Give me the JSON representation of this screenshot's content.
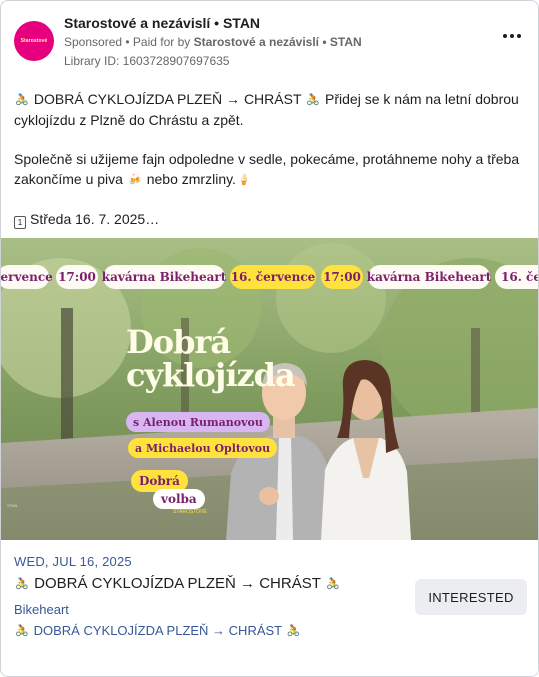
{
  "advertiser": {
    "avatar_text": "Starostové",
    "name": "Starostové a nezávislí • STAN",
    "sponsored_label": "Sponsored",
    "paid_for_prefix": " • Paid for by ",
    "payer": "Starostové a nezávislí • STAN",
    "library_id": "Library ID: 1603728907697635"
  },
  "post": {
    "line1": "DOBRÁ CYKLOJÍZDA PLZEŇ → CHRÁST",
    "line1_rest": "Přidej se k nám na letní dobrou cyklojízdu z Plzně do Chrástu a zpět.",
    "line2": "Společně si užijeme fajn odpoledne v sedle, pokecáme, protáhneme nohy a třeba zakončíme u piva",
    "line2_mid": "nebo zmrzliny.",
    "line3": "Středa 16. 7. 2025…",
    "emoji_bike": "🚴",
    "emoji_beer": "🍻",
    "emoji_icecream": "🍦",
    "emoji_calendar": "1"
  },
  "media": {
    "ticker": [
      "července",
      "17:00",
      "kavárna Bikeheart",
      "16. července",
      "17:00",
      "kavárna Bikeheart",
      "16. če"
    ],
    "headline_1": "Dobrá",
    "headline_2": "cyklojízda",
    "tag_1": "s Alenou Rumanovou",
    "tag_2": "a Michaelou Opltovou",
    "logo_top": "Dobrá",
    "logo_bottom": "volba",
    "logo_small": "STAROSTOVÉ",
    "corner_mark": "STAN"
  },
  "event": {
    "date": "WED, JUL 16, 2025",
    "title": "DOBRÁ CYKLOJÍZDA PLZEŇ → CHRÁST",
    "venue": "Bikeheart",
    "description": "DOBRÁ CYKLOJÍZDA PLZEŇ → CHRÁST",
    "interested_label": "INTERESTED"
  },
  "colors": {
    "link": "#385898",
    "brand_pink": "#e6007e",
    "brand_yellow": "#ffe23b",
    "brand_purple": "#7a1f6c"
  }
}
